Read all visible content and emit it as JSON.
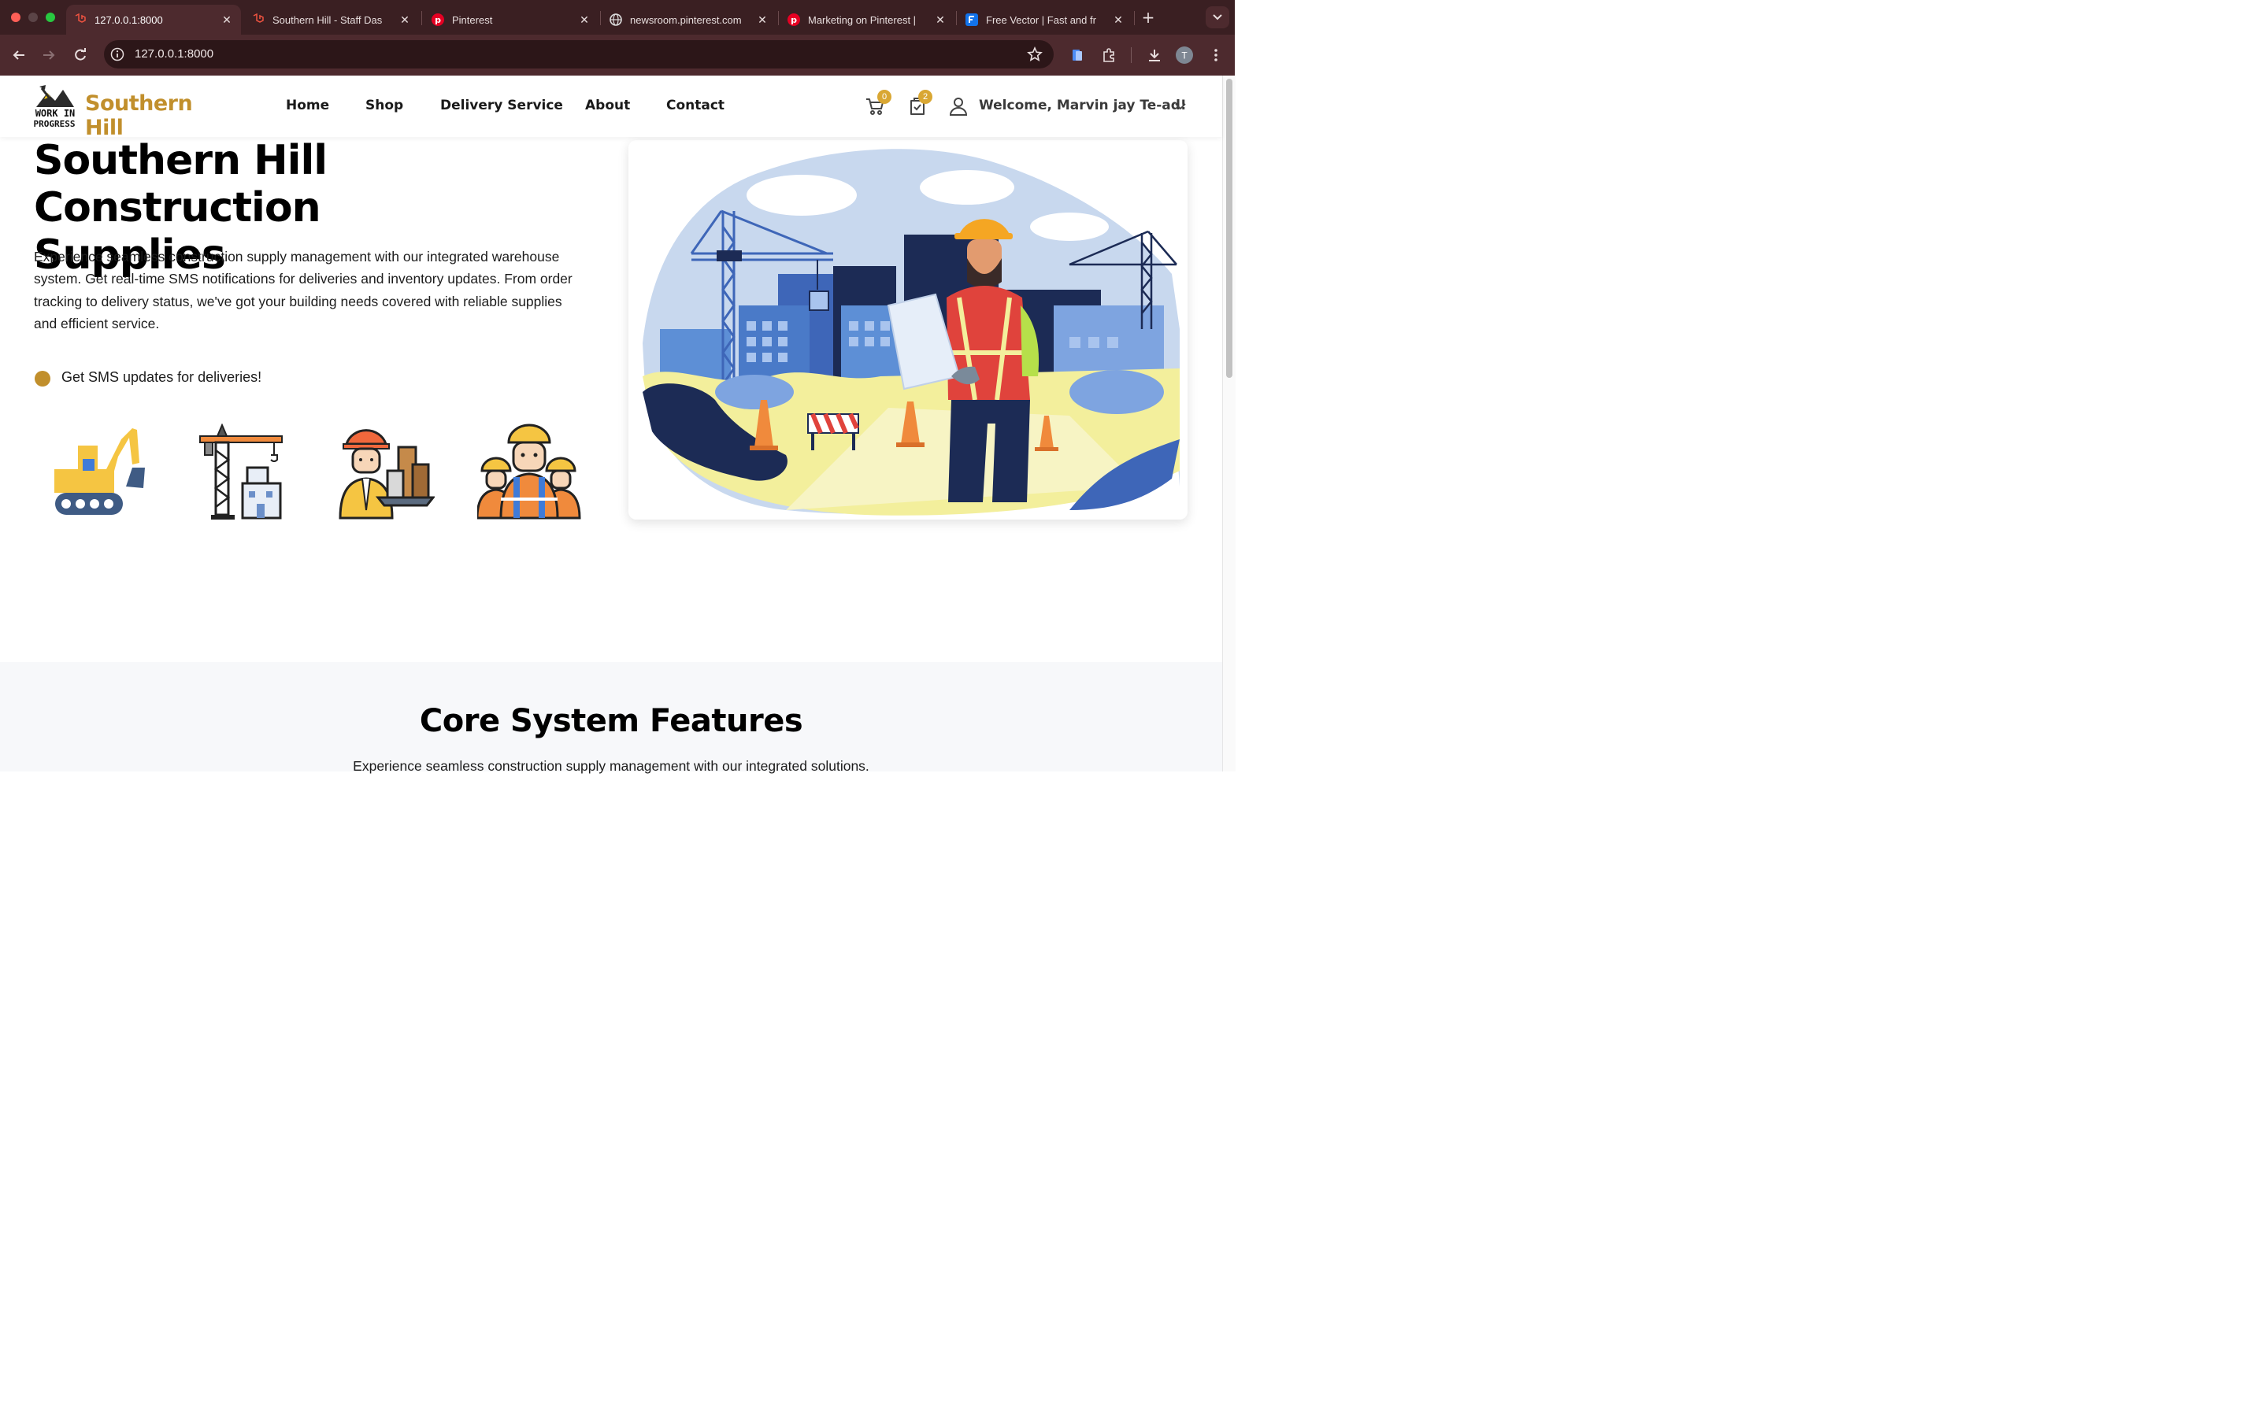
{
  "browser": {
    "tabs": [
      {
        "title": "127.0.0.1:8000",
        "icon": "laravel-icon"
      },
      {
        "title": "Southern Hill - Staff Das",
        "icon": "laravel-icon"
      },
      {
        "title": "Pinterest",
        "icon": "pinterest-icon"
      },
      {
        "title": "newsroom.pinterest.com",
        "icon": "globe-icon"
      },
      {
        "title": "Marketing on Pinterest |",
        "icon": "pinterest-icon"
      },
      {
        "title": "Free Vector | Fast and fr",
        "icon": "freepik-icon"
      }
    ],
    "url": "127.0.0.1:8000",
    "profile_initial": "T"
  },
  "header": {
    "logo_line1": "WORK IN",
    "logo_line2": "PROGRESS",
    "brand": "Southern Hill",
    "nav": [
      "Home",
      "Shop",
      "Delivery Service",
      "About",
      "Contact"
    ],
    "cart_count": "0",
    "orders_count": "2",
    "welcome": "Welcome, Marvin jay Te-ad!"
  },
  "hero": {
    "title_line1": "Southern Hill Construction",
    "title_line2": "Supplies",
    "description": "Experience seamless construction supply management with our integrated warehouse system. Get real-time SMS notifications for deliveries and inventory updates. From order tracking to delivery status, we've got your building needs covered with reliable supplies and efficient service.",
    "sms_note": "Get SMS updates for deliveries!",
    "icons": [
      "excavator-icon",
      "tower-crane-icon",
      "engineer-icon",
      "workers-team-icon"
    ]
  },
  "features": {
    "title": "Core System Features",
    "subtitle": "Experience seamless construction supply management with our integrated solutions."
  },
  "colors": {
    "accent": "#c18f2c",
    "badge": "#d9a733",
    "chrome_tab": "#3a1f22",
    "chrome_toolbar": "#4d2a2e"
  }
}
